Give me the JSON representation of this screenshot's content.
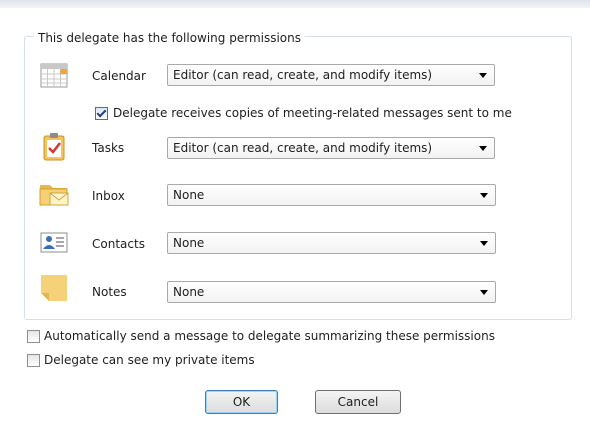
{
  "group_title": "This delegate has the following permissions",
  "rows": [
    {
      "label": "Calendar",
      "value": "Editor (can read, create, and modify items)",
      "icon": "calendar-icon"
    },
    {
      "label": "Tasks",
      "value": "Editor (can read, create, and modify items)",
      "icon": "tasks-icon"
    },
    {
      "label": "Inbox",
      "value": "None",
      "icon": "inbox-icon"
    },
    {
      "label": "Contacts",
      "value": "None",
      "icon": "contacts-icon"
    },
    {
      "label": "Notes",
      "value": "None",
      "icon": "notes-icon"
    }
  ],
  "meeting_copies": {
    "label": "Delegate receives copies of meeting-related messages sent to me",
    "checked": true
  },
  "auto_send": {
    "label": "Automatically send a message to delegate summarizing these permissions",
    "checked": false
  },
  "private_items": {
    "label": "Delegate can see my private items",
    "checked": false
  },
  "buttons": {
    "ok": "OK",
    "cancel": "Cancel"
  }
}
